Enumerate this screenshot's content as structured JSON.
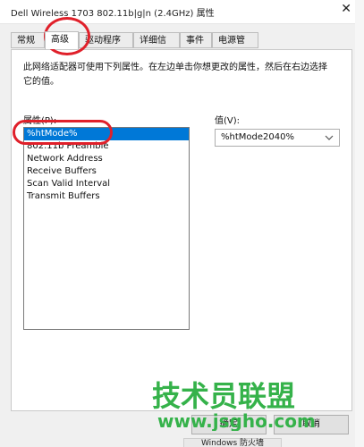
{
  "window": {
    "title": "Dell Wireless 1703 802.11b|g|n (2.4GHz) 属性",
    "close": "✕"
  },
  "tabs": [
    {
      "label": "常规",
      "active": false
    },
    {
      "label": "高级",
      "active": true
    },
    {
      "label": "驱动程序",
      "active": false
    },
    {
      "label": "详细信息",
      "active": false
    },
    {
      "label": "事件",
      "active": false
    },
    {
      "label": "电源管理",
      "active": false
    }
  ],
  "advanced": {
    "description": "此网络适配器可使用下列属性。在左边单击你想更改的属性，然后在右边选择它的值。",
    "property_label": "属性(P):",
    "value_label": "值(V):",
    "properties": [
      {
        "label": "%htMode%",
        "selected": true
      },
      {
        "label": "802.11b Preamble",
        "selected": false
      },
      {
        "label": "Network Address",
        "selected": false
      },
      {
        "label": "Receive Buffers",
        "selected": false
      },
      {
        "label": "Scan Valid Interval",
        "selected": false
      },
      {
        "label": "Transmit Buffers",
        "selected": false
      }
    ],
    "value_selected": "%htMode2040%"
  },
  "buttons": {
    "ok": "确定",
    "cancel": "取消"
  },
  "bottom": {
    "window_label": "Windows 防火墙"
  },
  "watermark": {
    "text": "技术员联盟",
    "url": "www.jsgho.com"
  },
  "colors": {
    "annotation_red": "#e0202a",
    "selection_blue": "#0078d7",
    "watermark_green": "#35b24a"
  }
}
